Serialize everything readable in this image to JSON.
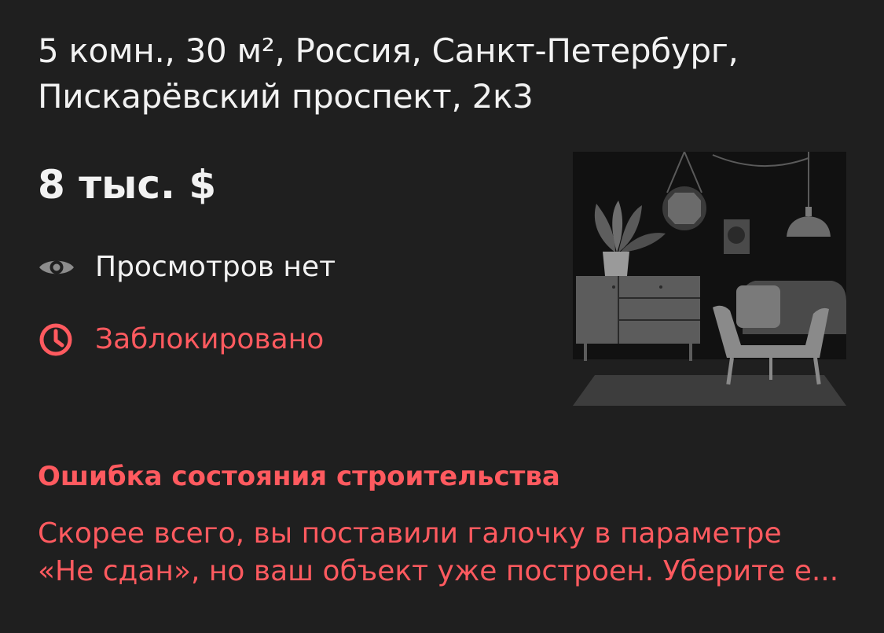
{
  "listing": {
    "title_line1": "5 комн., 30 м², Россия, Санкт-Петербург,",
    "title_line2": "Пискарёвский проспект, 2к3",
    "price": "8 тыс. $",
    "views_text": "Просмотров нет",
    "status_text": "Заблокировано",
    "views_icon": "eye-icon",
    "status_icon": "clock-icon",
    "illustration": "room-interior-placeholder"
  },
  "error": {
    "title": "Ошибка состояния строительства",
    "text_line1": "Скорее всего, вы поставили галочку в параметре",
    "text_line2": "«Не сдан», но ваш объект уже построен. Уберите е..."
  },
  "colors": {
    "background": "#1f1f1f",
    "text": "#f2f2f2",
    "error": "#ff5a5f",
    "icon_gray": "#8c8c8c"
  }
}
